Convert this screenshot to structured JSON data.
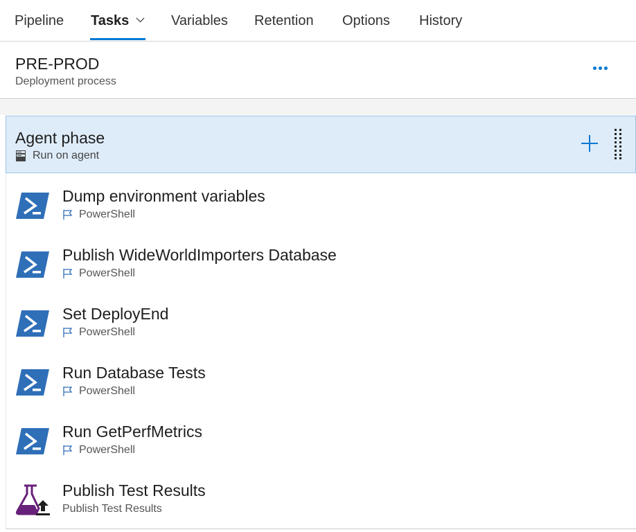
{
  "nav": {
    "tabs": [
      {
        "label": "Pipeline"
      },
      {
        "label": "Tasks"
      },
      {
        "label": "Variables"
      },
      {
        "label": "Retention"
      },
      {
        "label": "Options"
      },
      {
        "label": "History"
      }
    ],
    "active_tab": "Tasks"
  },
  "stage": {
    "title": "PRE-PROD",
    "subtitle": "Deployment process"
  },
  "phase": {
    "title": "Agent phase",
    "subtitle": "Run on agent"
  },
  "tasks": [
    {
      "name": "Dump environment variables",
      "type": "PowerShell",
      "icon": "powershell-icon"
    },
    {
      "name": "Publish WideWorldImporters Database",
      "type": "PowerShell",
      "icon": "powershell-icon"
    },
    {
      "name": "Set DeployEnd",
      "type": "PowerShell",
      "icon": "powershell-icon"
    },
    {
      "name": "Run Database Tests",
      "type": "PowerShell",
      "icon": "powershell-icon"
    },
    {
      "name": "Run GetPerfMetrics",
      "type": "PowerShell",
      "icon": "powershell-icon"
    },
    {
      "name": "Publish Test Results",
      "type": "Publish Test Results",
      "icon": "test-beaker-icon"
    }
  ],
  "colors": {
    "accent": "#0078d4",
    "phase_bg": "#deecf9",
    "powershell_blue": "#2f6fb8",
    "test_purple": "#68217a"
  }
}
